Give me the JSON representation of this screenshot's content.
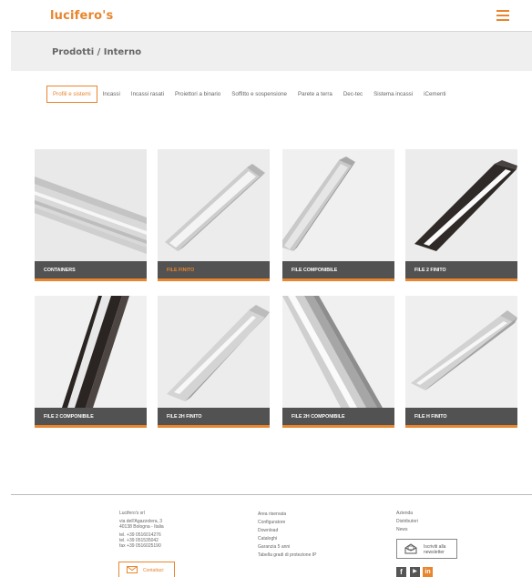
{
  "header": {
    "logo": "lucifero's",
    "menu_icon": "hamburger-menu-icon"
  },
  "breadcrumb": "Prodotti / Interno",
  "tabs": [
    {
      "label": "Profili e sistemi",
      "active": true
    },
    {
      "label": "Incassi",
      "active": false
    },
    {
      "label": "Incassi rasati",
      "active": false
    },
    {
      "label": "Proiettori a binario",
      "active": false
    },
    {
      "label": "Soffitto e sospensione",
      "active": false
    },
    {
      "label": "Parete a terra",
      "active": false
    },
    {
      "label": "Dec-tec",
      "active": false
    },
    {
      "label": "Sistema incassi",
      "active": false
    },
    {
      "label": "iCementi",
      "active": false
    }
  ],
  "products": [
    {
      "label": "CONTAINERS",
      "active": false
    },
    {
      "label": "FILE FINITO",
      "active": true
    },
    {
      "label": "FILE COMPONIBILE",
      "active": false
    },
    {
      "label": "FILE 2 FINITO",
      "active": false
    },
    {
      "label": "FILE 2 COMPONIBILE",
      "active": false
    },
    {
      "label": "FILE 2H FINITO",
      "active": false
    },
    {
      "label": "FILE 2H COMPONIBILE",
      "active": false
    },
    {
      "label": "FILE H FINITO",
      "active": false
    }
  ],
  "footer": {
    "company": {
      "name": "Lucifero's srl",
      "address1": "via dell'Agazzolera, 3",
      "address2": "40138 Bologna - Italia",
      "tel1": "tel. +39 0516014276",
      "tel2": "tel. +39 051535042",
      "fax": "fax +39 0516025190"
    },
    "contact_label": "Contattaci",
    "links_col2": [
      "Area riservata",
      "Configuratore",
      "Download",
      "Cataloghi",
      "Garanzia 5 anni",
      "Tabella gradi di protezione IP"
    ],
    "links_col3": [
      "Azienda",
      "Distributori",
      "News"
    ],
    "newsletter_line1": "Iscriviti alla",
    "newsletter_line2": "newsletter",
    "social": [
      "facebook-icon",
      "youtube-icon",
      "linkedin-icon"
    ]
  },
  "colors": {
    "accent": "#e8852d",
    "label_bg": "#525252",
    "crumb_bg": "#efefef"
  }
}
